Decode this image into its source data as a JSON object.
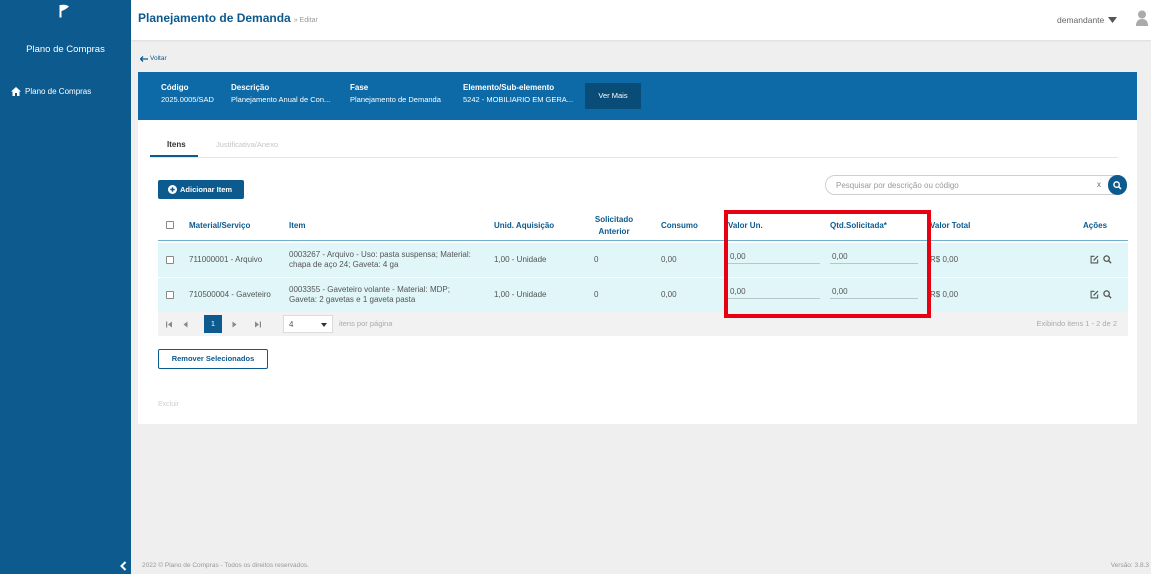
{
  "colors": {
    "primary": "#0c5a8e",
    "info_bar": "#0d6aa6",
    "button_dark": "#0a4c78",
    "row_background": "#e0f6f9",
    "annotation": "#e60012"
  },
  "sidebar": {
    "logo_icon": "brand-logo-icon",
    "brand": "Plano de Compras",
    "menu": [
      {
        "label": "Plano de Compras",
        "icon": "home-icon"
      }
    ],
    "collapse_icon": "chevron-left-icon"
  },
  "header": {
    "title": "Planejamento de Demanda",
    "subtitle": "» Editar",
    "username": "demandante",
    "dropdown_icon": "caret-down-icon",
    "user_icon": "user-icon"
  },
  "back": {
    "label": "Voltar",
    "icon": "arrow-left-icon"
  },
  "info_bar": {
    "fields": [
      {
        "label": "Código",
        "value": "2025.0005/SAD"
      },
      {
        "label": "Descrição",
        "value": "Planejamento Anual de Con..."
      },
      {
        "label": "Fase",
        "value": "Planejamento de Demanda"
      },
      {
        "label": "Elemento/Sub-elemento",
        "value": "5242 - MOBILIARIO EM GERA..."
      }
    ],
    "more_button": "Ver Mais"
  },
  "tabs": [
    {
      "label": "Itens",
      "active": true
    },
    {
      "label": "Justificativa/Anexo",
      "active": false
    }
  ],
  "toolbar": {
    "add_button": "Adicionar Item",
    "add_icon": "plus-circle-icon",
    "search_placeholder": "Pesquisar por descrição ou código",
    "clear_label": "x",
    "search_icon": "search-icon"
  },
  "table": {
    "columns": [
      "Material/Serviço",
      "Item",
      "Unid. Aquisição",
      "Solicitado Anterior",
      "Consumo",
      "Valor Un.",
      "Qtd.Solicitada*",
      "Valor Total",
      "Ações"
    ],
    "rows": [
      {
        "selected": false,
        "material": "711000001 - Arquivo",
        "item": "0003267 - Arquivo - Uso: pasta suspensa; Material: chapa de aço 24; Gaveta: 4 ga",
        "unit": "1,00 - Unidade",
        "previous": "0",
        "consumption": "0,00",
        "unit_value": "0,00",
        "quantity": "0,00",
        "total": "R$ 0,00"
      },
      {
        "selected": false,
        "material": "710500004 - Gaveteiro",
        "item": "0003355 - Gaveteiro volante - Material: MDP; Gaveta: 2 gavetas e 1 gaveta pasta",
        "unit": "1,00 - Unidade",
        "previous": "0",
        "consumption": "0,00",
        "unit_value": "0,00",
        "quantity": "0,00",
        "total": "R$ 0,00"
      }
    ],
    "row_action_icons": [
      "edit-icon",
      "search-icon"
    ]
  },
  "pager": {
    "nav_icons": [
      "first-page-icon",
      "previous-page-icon",
      "next-page-icon",
      "last-page-icon"
    ],
    "current_page": "1",
    "page_size": "4",
    "page_size_label": "itens por página",
    "summary": "Exibindo itens 1 - 2 de 2"
  },
  "remove_button": "Remover Selecionados",
  "delete_label": "Excluir",
  "footer": {
    "copyright": "2022 © Plano de Compras - Todos os direitos reservados.",
    "version": "Versão: 3.8.3"
  }
}
